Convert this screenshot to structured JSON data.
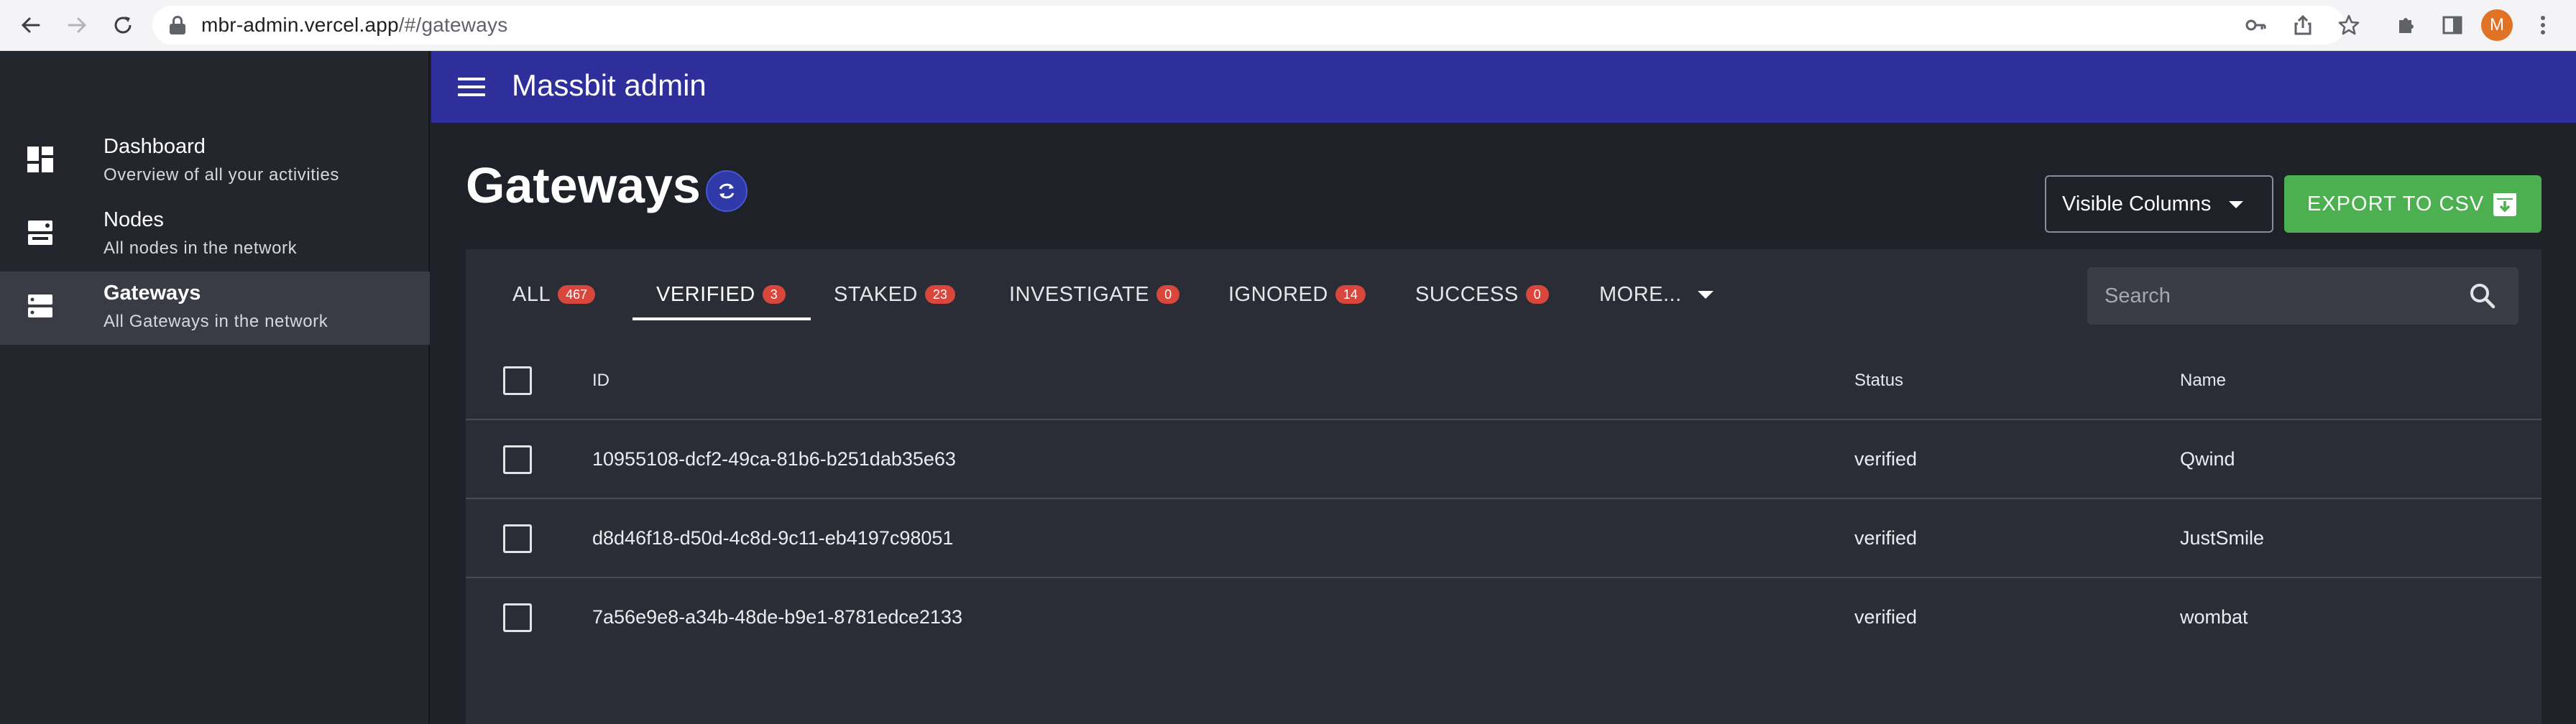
{
  "browser": {
    "url_host": "mbr-admin.vercel.app",
    "url_path": "/#/gateways",
    "profile_initial": "M"
  },
  "app": {
    "title": "Massbit admin"
  },
  "sidebar": {
    "items": [
      {
        "title": "Dashboard",
        "subtitle": "Overview of all your activities",
        "icon": "dashboard-icon"
      },
      {
        "title": "Nodes",
        "subtitle": "All nodes in the network",
        "icon": "nodes-icon"
      },
      {
        "title": "Gateways",
        "subtitle": "All Gateways in the network",
        "icon": "gateways-icon",
        "active": true
      }
    ]
  },
  "page": {
    "title": "Gateways",
    "visible_columns_label": "Visible Columns",
    "export_label": "EXPORT TO CSV",
    "search_placeholder": "Search"
  },
  "tabs": [
    {
      "label": "ALL",
      "count": "467"
    },
    {
      "label": "VERIFIED",
      "count": "3",
      "active": true
    },
    {
      "label": "STAKED",
      "count": "23"
    },
    {
      "label": "INVESTIGATE",
      "count": "0"
    },
    {
      "label": "IGNORED",
      "count": "14"
    },
    {
      "label": "SUCCESS",
      "count": "0"
    },
    {
      "label": "MORE..."
    }
  ],
  "table": {
    "columns": [
      "ID",
      "Status",
      "Name"
    ],
    "rows": [
      {
        "id": "10955108-dcf2-49ca-81b6-b251dab35e63",
        "status": "verified",
        "name": "Qwind"
      },
      {
        "id": "d8d46f18-d50d-4c8d-9c11-eb4197c98051",
        "status": "verified",
        "name": "JustSmile"
      },
      {
        "id": "7a56e9e8-a34b-48de-b9e1-8781edce2133",
        "status": "verified",
        "name": "wombat"
      }
    ]
  },
  "colors": {
    "appbar": "#2e2f9b",
    "export_button": "#4caf50",
    "count_badge": "#d9463b",
    "background": "#1f2129"
  }
}
